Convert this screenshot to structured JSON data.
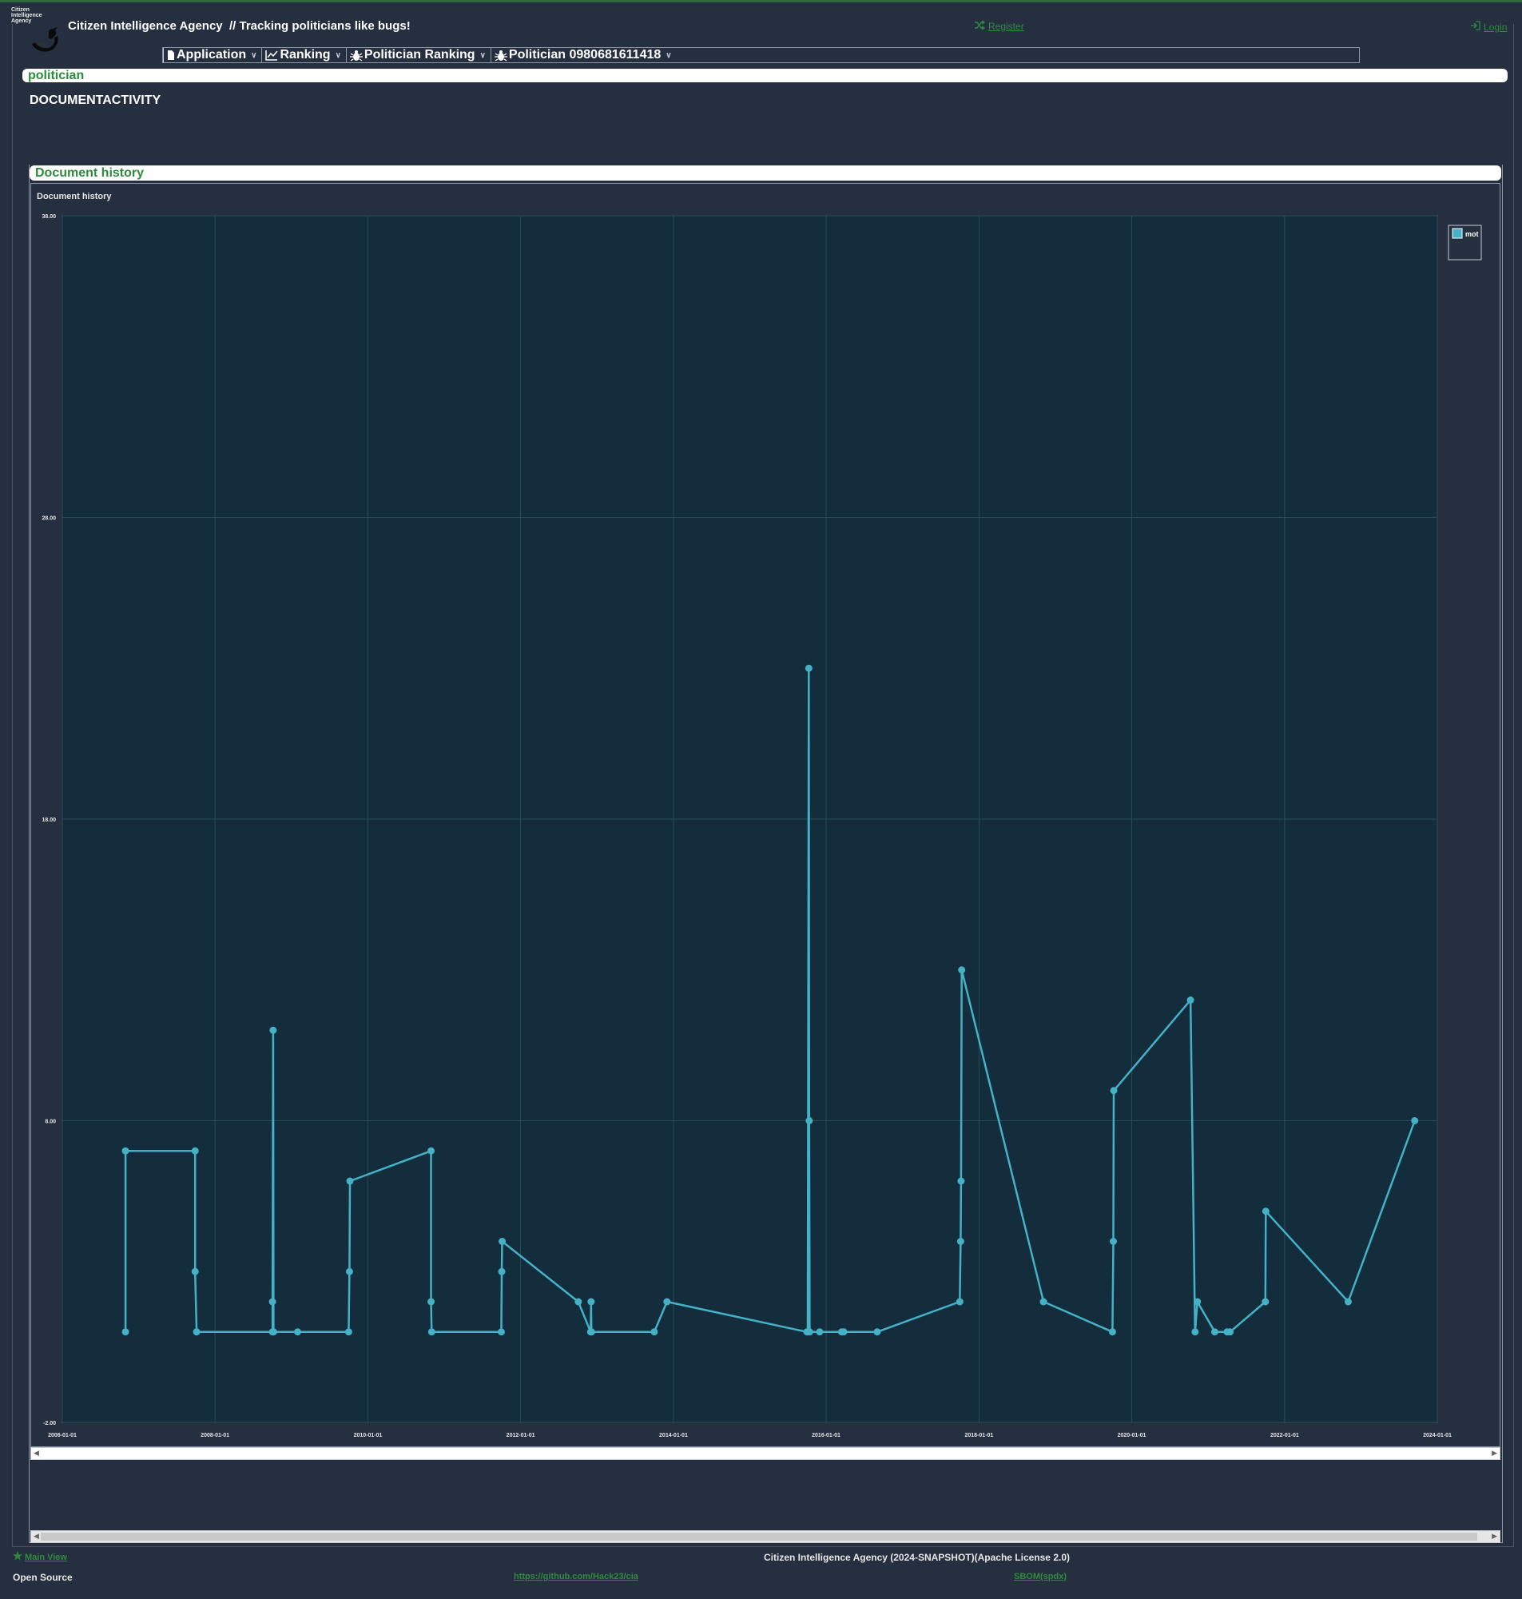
{
  "header": {
    "logo_text": "Citizen Intelligence Agency",
    "app_title": "Citizen Intelligence Agency",
    "tagline": "// Tracking politicians like bugs!",
    "register_label": "Register",
    "login_label": "Login"
  },
  "menu": {
    "items": [
      {
        "label": "Application",
        "icon": "document-icon"
      },
      {
        "label": "Ranking",
        "icon": "line-chart-icon"
      },
      {
        "label": "Politician Ranking",
        "icon": "bug-icon"
      },
      {
        "label": "Politician 0980681611418",
        "icon": "bug-icon"
      }
    ]
  },
  "page": {
    "section_caption": "politician",
    "title": "DOCUMENTACTIVITY",
    "panel_caption": "Document history"
  },
  "chart_data": {
    "type": "line",
    "title": "Document history",
    "xlabel": "",
    "ylabel": "",
    "ylim": [
      -2,
      38
    ],
    "xlim": [
      "2006-01-01",
      "2024-01-01"
    ],
    "x_ticks": [
      "2006-01-01",
      "2008-01-01",
      "2010-01-01",
      "2012-01-01",
      "2014-01-01",
      "2016-01-01",
      "2018-01-01",
      "2020-01-01",
      "2022-01-01",
      "2024-01-01"
    ],
    "y_ticks": [
      "-2.00",
      "8.00",
      "18.00",
      "28.00",
      "38.00"
    ],
    "grid": true,
    "legend_position": "top-right",
    "series": [
      {
        "name": "mot",
        "color": "#45b1c6",
        "points": [
          [
            "2006-10-30",
            1
          ],
          [
            "2006-10-30",
            7
          ],
          [
            "2007-09-28",
            7
          ],
          [
            "2007-09-28",
            3
          ],
          [
            "2007-10-05",
            1
          ],
          [
            "2008-10-02",
            1
          ],
          [
            "2008-10-02",
            2
          ],
          [
            "2008-10-05",
            11
          ],
          [
            "2008-10-07",
            1
          ],
          [
            "2009-01-30",
            1
          ],
          [
            "2009-10-01",
            1
          ],
          [
            "2009-10-05",
            3
          ],
          [
            "2009-10-07",
            6
          ],
          [
            "2010-10-30",
            7
          ],
          [
            "2010-10-30",
            2
          ],
          [
            "2010-11-02",
            1
          ],
          [
            "2011-10-01",
            1
          ],
          [
            "2011-10-03",
            3
          ],
          [
            "2011-10-05",
            4
          ],
          [
            "2012-10-03",
            2
          ],
          [
            "2012-12-01",
            1
          ],
          [
            "2012-12-03",
            2
          ],
          [
            "2012-12-05",
            1
          ],
          [
            "2013-10-01",
            1
          ],
          [
            "2013-12-01",
            2
          ],
          [
            "2015-10-01",
            1
          ],
          [
            "2015-10-05",
            1
          ],
          [
            "2015-10-10",
            23
          ],
          [
            "2015-10-12",
            8
          ],
          [
            "2015-10-14",
            1
          ],
          [
            "2015-12-01",
            1
          ],
          [
            "2016-03-15",
            1
          ],
          [
            "2016-03-25",
            1
          ],
          [
            "2016-09-01",
            1
          ],
          [
            "2017-10-01",
            2
          ],
          [
            "2017-10-05",
            4
          ],
          [
            "2017-10-07",
            6
          ],
          [
            "2017-10-10",
            13
          ],
          [
            "2018-11-05",
            2
          ],
          [
            "2019-10-01",
            1
          ],
          [
            "2019-10-05",
            4
          ],
          [
            "2019-10-07",
            9
          ],
          [
            "2020-10-08",
            12
          ],
          [
            "2020-10-30",
            1
          ],
          [
            "2020-11-10",
            2
          ],
          [
            "2021-02-01",
            1
          ],
          [
            "2021-04-01",
            1
          ],
          [
            "2021-04-15",
            1
          ],
          [
            "2021-10-01",
            2
          ],
          [
            "2021-10-03",
            5
          ],
          [
            "2022-11-01",
            2
          ],
          [
            "2023-09-15",
            8
          ]
        ]
      }
    ]
  },
  "footer": {
    "main_view_label": "Main View",
    "copyright": "Citizen Intelligence Agency (2024-SNAPSHOT)(Apache License 2.0)",
    "open_source_label": "Open Source",
    "github_link": "https://github.com/Hack23/cia",
    "sbom_link": "SBOM(spdx)"
  },
  "colors": {
    "background": "#252f3f",
    "plot_background": "#132d3d",
    "accent_green": "#2e8b3d",
    "series": "#45b1c6"
  }
}
